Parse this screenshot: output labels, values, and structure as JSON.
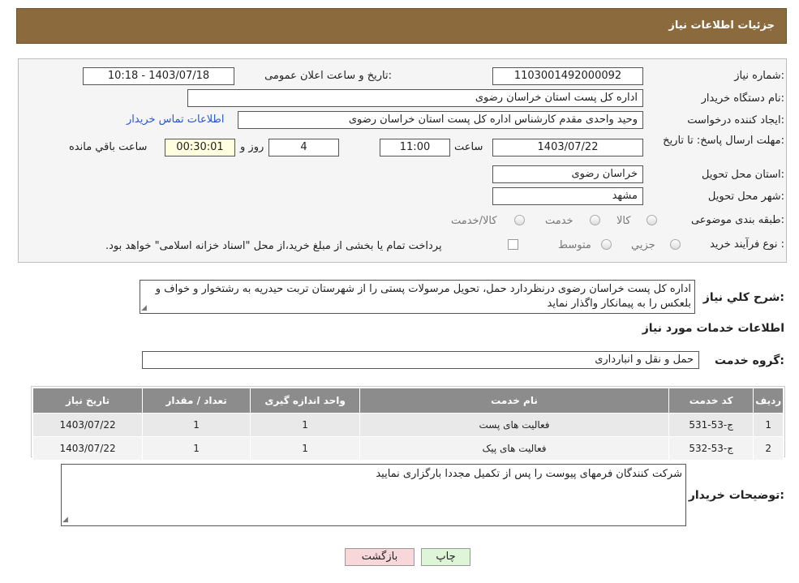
{
  "header": {
    "title": "جزئیات اطلاعات نیاز"
  },
  "form": {
    "need_number_label": "شماره نیاز:",
    "need_number": "1103001492000092",
    "announce_label": "تاریخ و ساعت اعلان عمومی:",
    "announce_value": "1403/07/18 - 10:18",
    "buyer_org_label": "نام دستگاه خریدار:",
    "buyer_org": "اداره کل پست استان خراسان رضوی",
    "creator_label": "ایجاد کننده درخواست:",
    "creator": "وحید واحدی مقدم کارشناس اداره کل پست استان خراسان رضوی",
    "contact_link": "اطلاعات تماس خریدار",
    "deadline_label": "مهلت ارسال پاسخ: تا تاریخ:",
    "deadline_date": "1403/07/22",
    "time_label": "ساعت",
    "deadline_time": "11:00",
    "days_value": "4",
    "days_label": "روز و",
    "remaining_time": "00:30:01",
    "remaining_label": "ساعت باقي مانده",
    "province_label": "استان محل تحویل:",
    "province": "خراسان رضوی",
    "city_label": "شهر محل تحویل:",
    "city": "مشهد",
    "category_label": "طبقه بندی موضوعی:",
    "category_options": [
      "کالا",
      "خدمت",
      "کالا/خدمت"
    ],
    "process_label": "نوع فرآیند خرید :",
    "process_options": [
      "جزیي",
      "متوسط"
    ],
    "payment_note": "پرداخت تمام یا بخشی از مبلغ خرید،از محل \"اسناد خزانه اسلامی\" خواهد بود.",
    "description_label": "شرح کلي نیاز:",
    "description": "اداره کل پست خراسان رضوی درنظردارد حمل، تحویل مرسولات پستی را از شهرستان تربت حیدریه به رشتخوار و خواف و بلعکس را به پیمانکار واگذار نماید"
  },
  "services": {
    "section_title": "اطلاعات خدمات مورد نیاز",
    "group_label": "گروه خدمت:",
    "group_value": "حمل و نقل و انبارداری",
    "columns": [
      "ردیف",
      "کد خدمت",
      "نام خدمت",
      "واحد اندازه گیری",
      "تعداد / مقدار",
      "تاریخ نیاز"
    ],
    "rows": [
      [
        "1",
        "ج-53-531",
        "فعالیت های پست",
        "1",
        "1",
        "1403/07/22"
      ],
      [
        "2",
        "ج-53-532",
        "فعالیت های پیک",
        "1",
        "1",
        "1403/07/22"
      ]
    ]
  },
  "buyer_notes": {
    "label": "توضیحات خریدار:",
    "text": "شرکت کنندگان فرمهای پیوست را پس از تکمیل مجددا بارگزاری نمایید"
  },
  "buttons": {
    "print": "چاپ",
    "back": "بازگشت"
  },
  "colors": {
    "header_bg": "#8b6b3d",
    "table_header_bg": "#8c8c8c",
    "back_button_bg": "#f8d7da",
    "print_button_bg": "#dff5d8",
    "link": "#2a57c9"
  }
}
